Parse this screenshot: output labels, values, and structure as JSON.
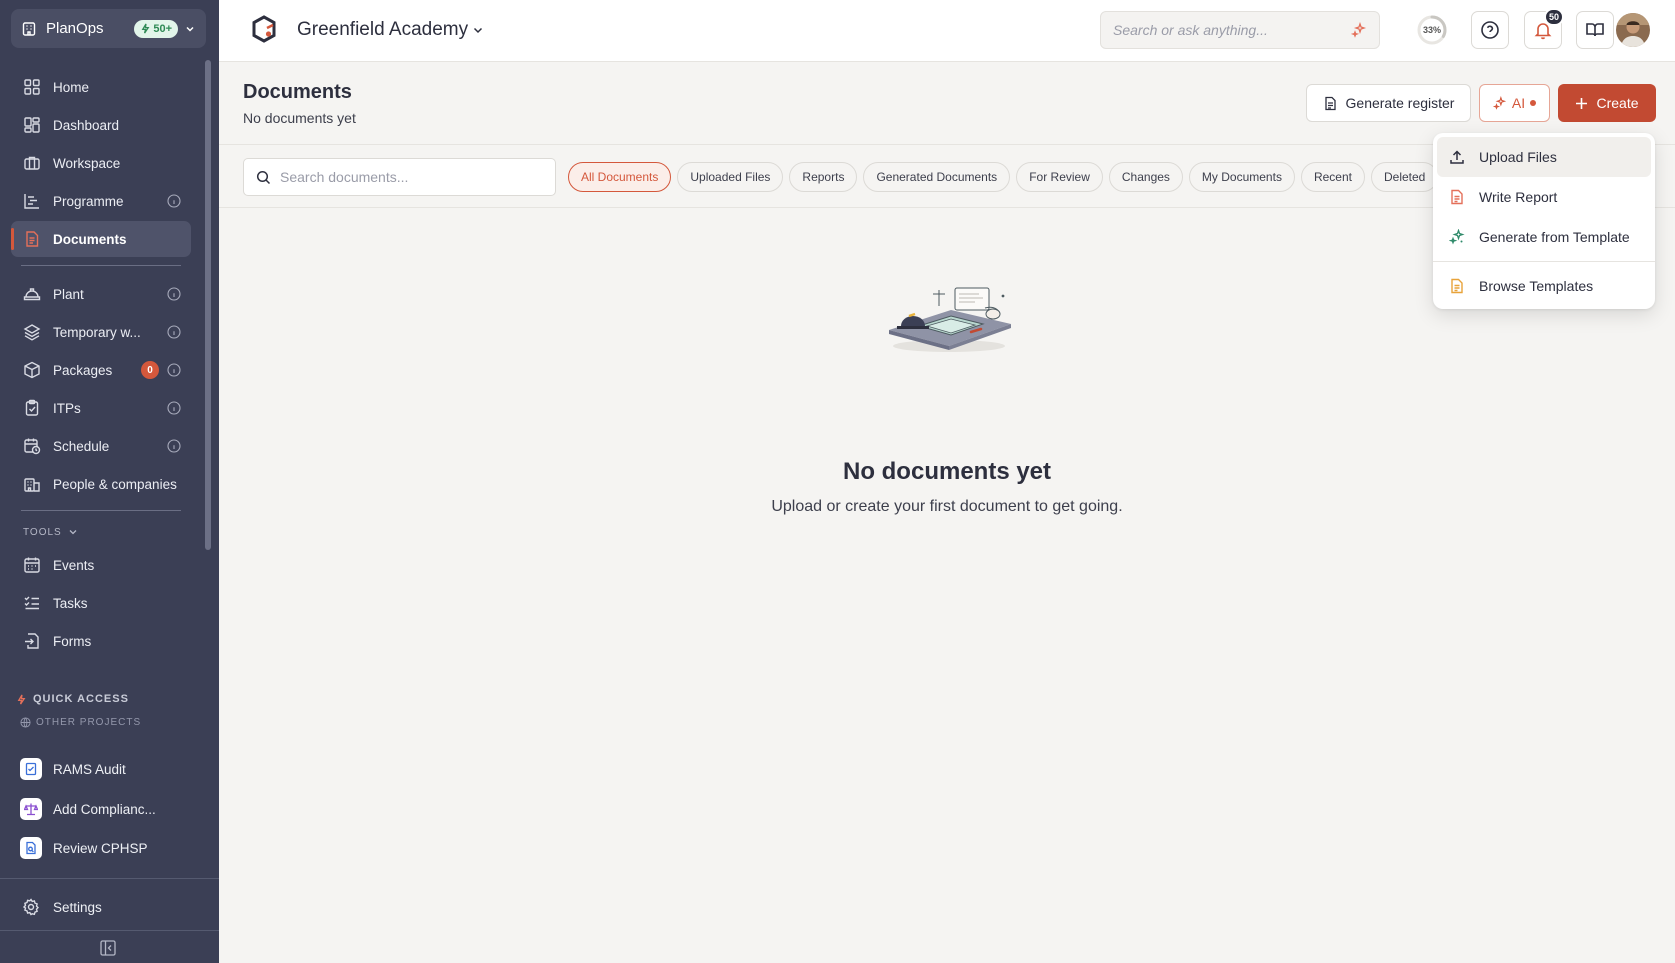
{
  "workspace": {
    "name": "PlanOps",
    "badge": "50+"
  },
  "nav": {
    "items": [
      {
        "label": "Home",
        "icon": "grid-icon"
      },
      {
        "label": "Dashboard",
        "icon": "dashboard-icon"
      },
      {
        "label": "Workspace",
        "icon": "briefcase-icon"
      },
      {
        "label": "Programme",
        "icon": "gantt-icon",
        "info": true
      },
      {
        "label": "Documents",
        "icon": "document-icon",
        "active": true
      }
    ],
    "items2": [
      {
        "label": "Plant",
        "icon": "hardhat-icon",
        "info": true
      },
      {
        "label": "Temporary w...",
        "icon": "layers-icon",
        "info": true
      },
      {
        "label": "Packages",
        "icon": "package-icon",
        "info": true,
        "count": "0"
      },
      {
        "label": "ITPs",
        "icon": "clipboard-icon",
        "info": true
      },
      {
        "label": "Schedule",
        "icon": "calendar-clock-icon",
        "info": true
      },
      {
        "label": "People & companies",
        "icon": "building-icon"
      }
    ],
    "tools_label": "TOOLS",
    "tools": [
      {
        "label": "Events",
        "icon": "calendar-icon"
      },
      {
        "label": "Tasks",
        "icon": "checklist-icon"
      },
      {
        "label": "Forms",
        "icon": "form-icon"
      }
    ]
  },
  "quick_access": {
    "title": "QUICK ACCESS",
    "subtitle": "OTHER PROJECTS",
    "items": [
      {
        "label": "RAMS Audit",
        "icon": "checklist-doc-icon"
      },
      {
        "label": "Add Complianc...",
        "icon": "scale-icon"
      },
      {
        "label": "Review CPHSP",
        "icon": "doc-review-icon"
      }
    ]
  },
  "settings_label": "Settings",
  "topbar": {
    "project": "Greenfield Academy",
    "search_placeholder": "Search or ask anything...",
    "progress": "33%",
    "progress_value": 0.33,
    "notifications": "50"
  },
  "page": {
    "title": "Documents",
    "subtitle": "No documents yet",
    "generate_register": "Generate register",
    "ai_label": "AI",
    "create_label": "Create"
  },
  "filters": {
    "search_placeholder": "Search documents...",
    "chips": [
      "All Documents",
      "Uploaded Files",
      "Reports",
      "Generated Documents",
      "For Review",
      "Changes",
      "My Documents",
      "Recent",
      "Deleted"
    ],
    "active": 0
  },
  "empty": {
    "title": "No documents yet",
    "subtitle": "Upload or create your first document to get going."
  },
  "create_menu": {
    "items": [
      {
        "label": "Upload Files",
        "icon": "upload-icon"
      },
      {
        "label": "Write Report",
        "icon": "report-icon"
      },
      {
        "label": "Generate from Template",
        "icon": "sparkle-icon"
      }
    ],
    "extra": {
      "label": "Browse Templates",
      "icon": "template-icon"
    }
  },
  "colors": {
    "accent": "#c24a32",
    "sidebar": "#3b3f55",
    "success": "#2f8a55"
  }
}
